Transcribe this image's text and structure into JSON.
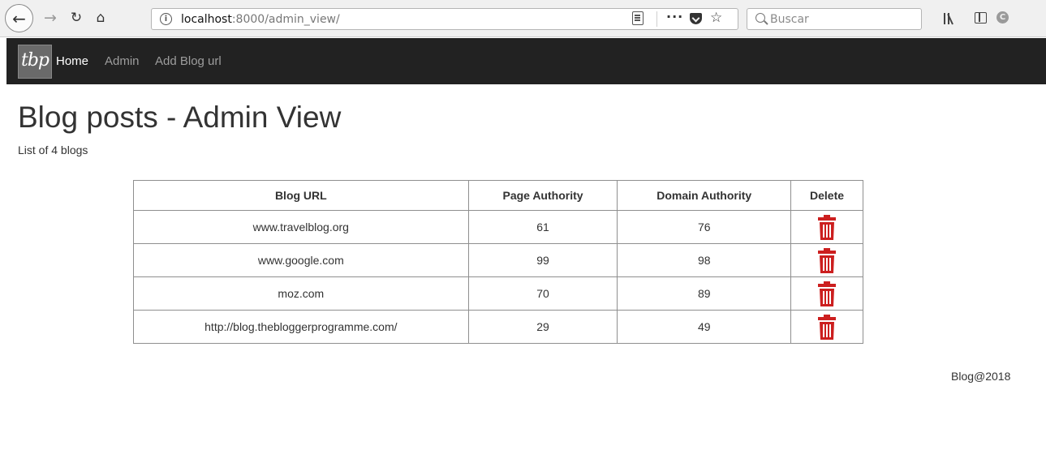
{
  "browser": {
    "url_host": "localhost",
    "url_path": ":8000/admin_view/",
    "search_placeholder": "Buscar"
  },
  "navbar": {
    "brand": "tbp",
    "links": [
      "Home",
      "Admin",
      "Add Blog url"
    ]
  },
  "page": {
    "title": "Blog posts - Admin View",
    "subtitle": "List of 4 blogs"
  },
  "table": {
    "headers": [
      "Blog URL",
      "Page Authority",
      "Domain Authority",
      "Delete"
    ],
    "rows": [
      {
        "url": "www.travelblog.org",
        "page_authority": "61",
        "domain_authority": "76"
      },
      {
        "url": "www.google.com",
        "page_authority": "99",
        "domain_authority": "98"
      },
      {
        "url": "moz.com",
        "page_authority": "70",
        "domain_authority": "89"
      },
      {
        "url": "http://blog.thebloggerprogramme.com/",
        "page_authority": "29",
        "domain_authority": "49"
      }
    ],
    "delete_icon": "trash-icon",
    "delete_color": "#cc1f1f"
  },
  "footer": "Blog@2018",
  "colors": {
    "navbar_bg": "#222222",
    "nav_active": "#ffffff",
    "nav_inactive": "#9d9d9d"
  }
}
